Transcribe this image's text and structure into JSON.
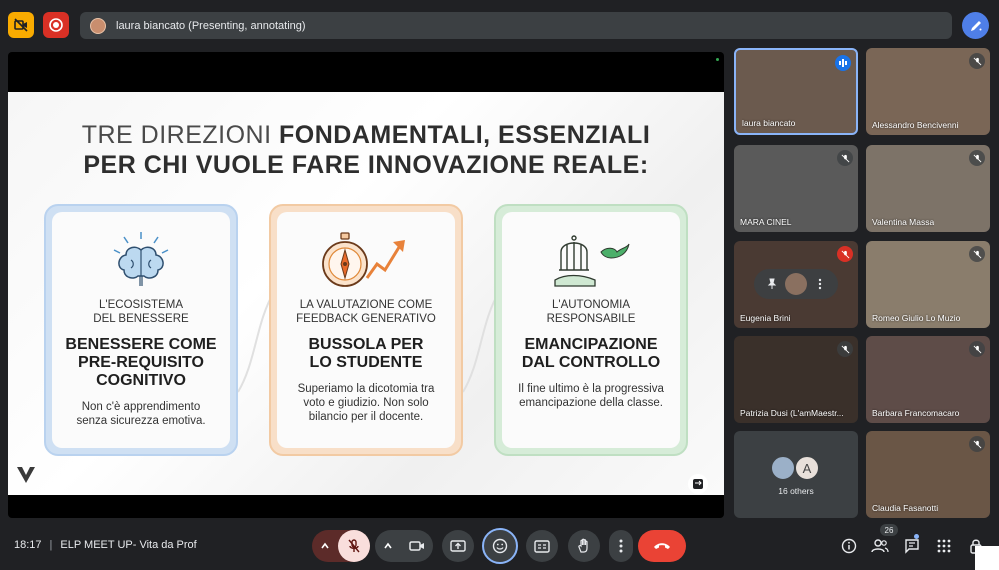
{
  "topbar": {
    "presenter_text": "laura biancato (Presenting, annotating)"
  },
  "slide": {
    "title_line1_light": "TRE DIREZIONI",
    "title_line1_bold": "FONDAMENTALI, ESSENZIALI",
    "title_line2": "PER CHI VUOLE FARE INNOVAZIONE REALE:",
    "cards": [
      {
        "icon": "brain-icon",
        "sub_line1": "L'ECOSISTEMA",
        "sub_line2": "DEL BENESSERE",
        "head_line1": "BENESSERE COME",
        "head_line2": "PRE-REQUISITO",
        "head_line3": "COGNITIVO",
        "desc_line1": "Non c'è apprendimento",
        "desc_line2": "senza sicurezza emotiva."
      },
      {
        "icon": "compass-icon",
        "sub_line1": "LA VALUTAZIONE COME",
        "sub_line2": "FEEDBACK GENERATIVO",
        "head_line1": "BUSSOLA PER",
        "head_line2": "LO STUDENTE",
        "desc_line1": "Superiamo la dicotomia tra",
        "desc_line2": "voto e giudizio. Non solo",
        "desc_line3": "bilancio per il docente."
      },
      {
        "icon": "birdcage-icon",
        "sub_line1": "L'AUTONOMIA",
        "sub_line2": "RESPONSABILE",
        "head_line1": "EMANCIPAZIONE",
        "head_line2": "DAL CONTROLLO",
        "desc_line1": "Il fine ultimo è la progressiva",
        "desc_line2": "emancipazione della classe."
      }
    ]
  },
  "participants": [
    {
      "name": "laura biancato",
      "status": "speaking",
      "bg": "#6b5a4e"
    },
    {
      "name": "Alessandro Bencivenni",
      "status": "muted",
      "bg": "#7a6656"
    },
    {
      "name": "MARA CINEL",
      "status": "muted",
      "bg": "#5a5a5a"
    },
    {
      "name": "Valentina Massa",
      "status": "muted",
      "bg": "#7d7368"
    },
    {
      "name": "Eugenia Brini",
      "status": "muted-red",
      "bg": "#4a3a33"
    },
    {
      "name": "Romeo Giulio Lo Muzio",
      "status": "muted",
      "bg": "#8a7d6c"
    },
    {
      "name": "Patrizia Dusi (L'amMaestr...",
      "status": "muted",
      "bg": "#3a302a"
    },
    {
      "name": "Barbara Francomacaro",
      "status": "muted",
      "bg": "#5e4c48"
    },
    {
      "name": "16 others",
      "status": "none",
      "bg": "#3c4043"
    },
    {
      "name": "Claudia Fasanotti",
      "status": "muted",
      "bg": "#6a5646"
    }
  ],
  "others": {
    "avatar_letter": "A",
    "label": "16 others"
  },
  "bottombar": {
    "time": "18:17",
    "meeting_name": "ELP MEET UP- Vita da Prof",
    "people_count": "26"
  }
}
